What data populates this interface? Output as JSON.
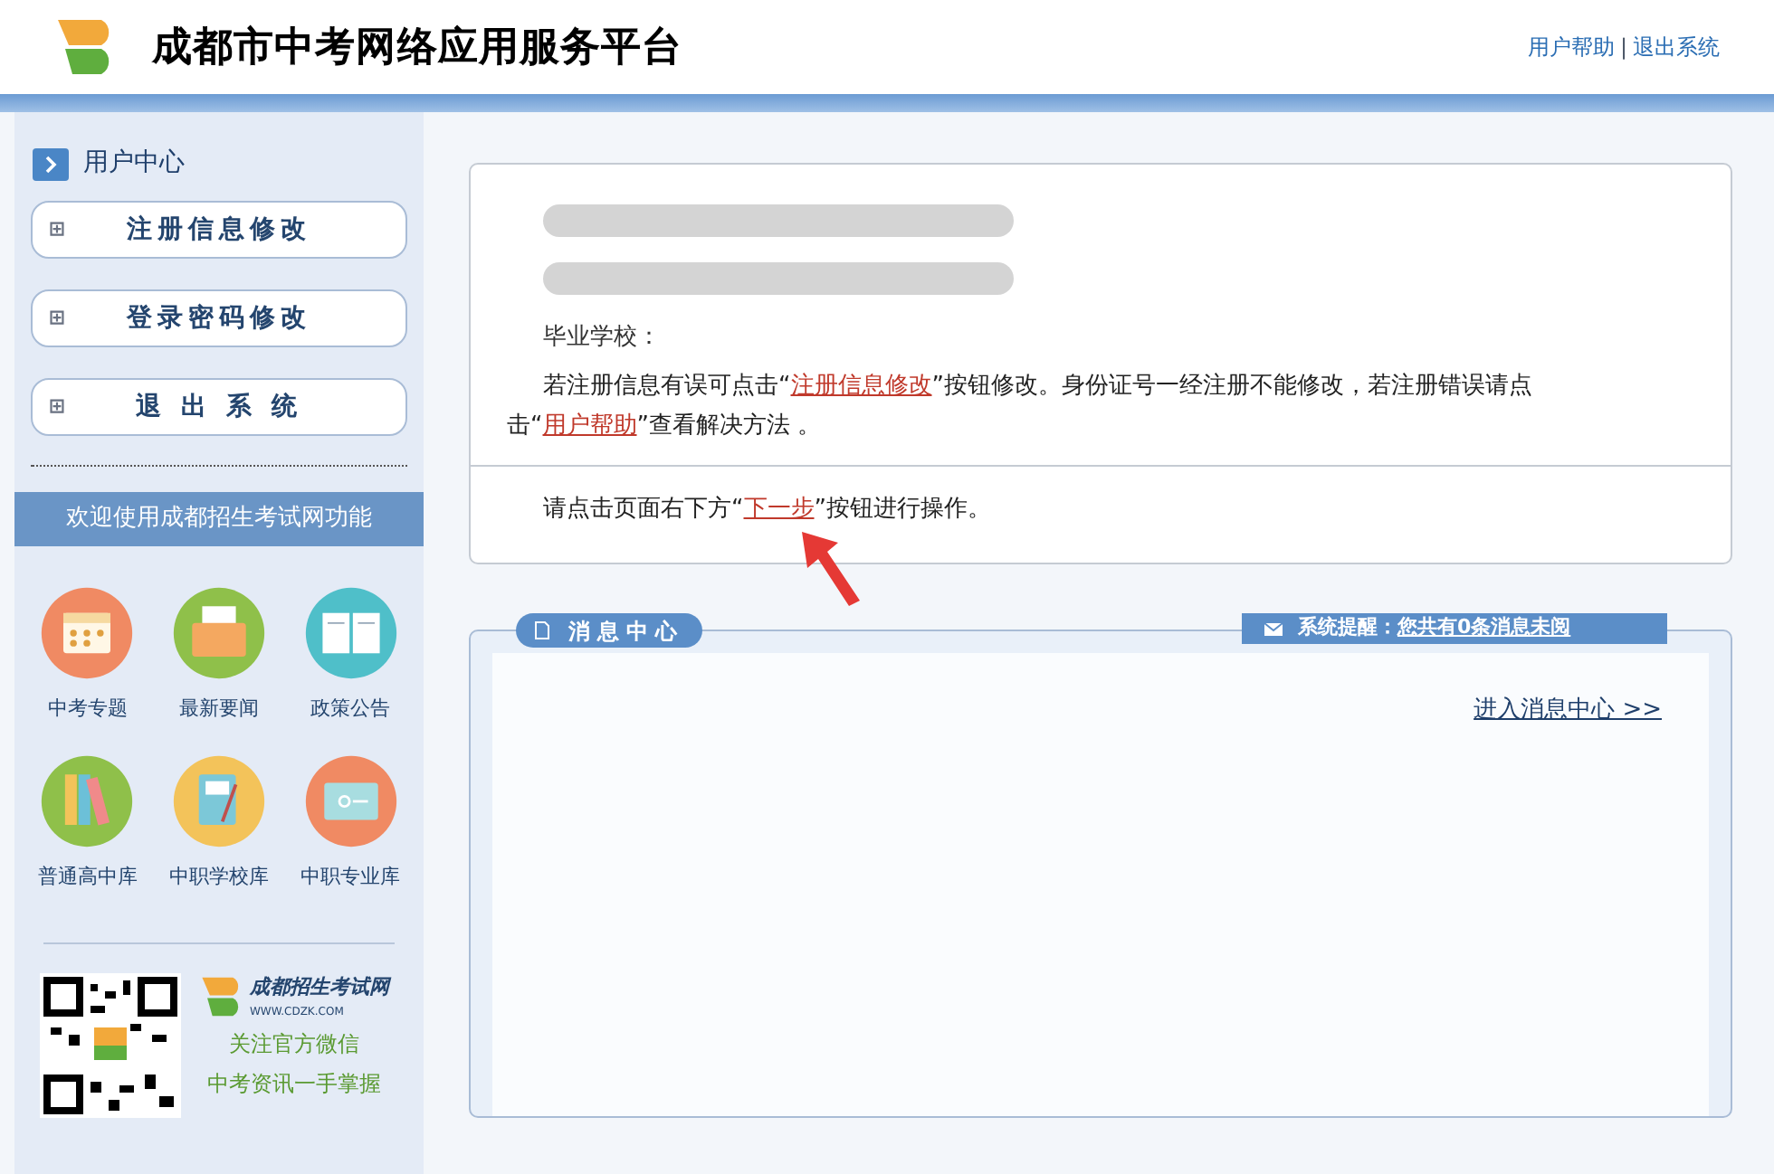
{
  "header": {
    "title": "成都市中考网络应用服务平台",
    "links": [
      "用户帮助",
      "退出系统"
    ],
    "separator": "|"
  },
  "sidebar": {
    "section_title": "用户中心",
    "buttons": [
      {
        "icon": "⊞",
        "label": "注册信息修改"
      },
      {
        "icon": "⊞",
        "label": "登录密码修改"
      },
      {
        "icon": "⊞",
        "label": "退 出 系 统"
      }
    ],
    "banner": "欢迎使用成都招生考试网功能",
    "features": [
      {
        "kind": "calendar",
        "label": "中考专题",
        "color": "#f08a63"
      },
      {
        "kind": "folder",
        "label": "最新要闻",
        "color": "#8fc04a"
      },
      {
        "kind": "book",
        "label": "政策公告",
        "color": "#4fbfc9"
      },
      {
        "kind": "binders",
        "label": "普通高中库",
        "color": "#8fc04a"
      },
      {
        "kind": "notebook",
        "label": "中职学校库",
        "color": "#f3c35a"
      },
      {
        "kind": "screen",
        "label": "中职专业库",
        "color": "#f08a63"
      }
    ],
    "promo": {
      "site_name": "成都招生考试网",
      "site_url": "WWW.CDZK.COM",
      "lines": [
        "关注官方微信",
        "中考资讯一手掌握"
      ]
    }
  },
  "notice": {
    "lines": [
      {
        "kind": "redacted"
      },
      {
        "kind": "redacted"
      },
      {
        "kind": "text",
        "text": "毕业学校："
      }
    ],
    "info_parts": [
      {
        "kind": "text",
        "text": "若注册信息有误可点击“"
      },
      {
        "kind": "link",
        "text": "注册信息修改"
      },
      {
        "kind": "text",
        "text": "”按钮修改。身份证号一经注册不能修改，若注册错误请点击“"
      },
      {
        "kind": "link",
        "text": "用户帮助"
      },
      {
        "kind": "text",
        "text": "”查看解决方法 。"
      }
    ],
    "next_parts": [
      {
        "kind": "text",
        "text": "请点击页面右下方“"
      },
      {
        "kind": "link",
        "text": "下一步"
      },
      {
        "kind": "text",
        "text": "”按钮进行操作。"
      }
    ]
  },
  "messages": {
    "title": "消息中心",
    "reminder_label": "系统提醒：",
    "reminder_link": "您共有0条消息未阅",
    "enter_link": "进入消息中心 >>"
  }
}
